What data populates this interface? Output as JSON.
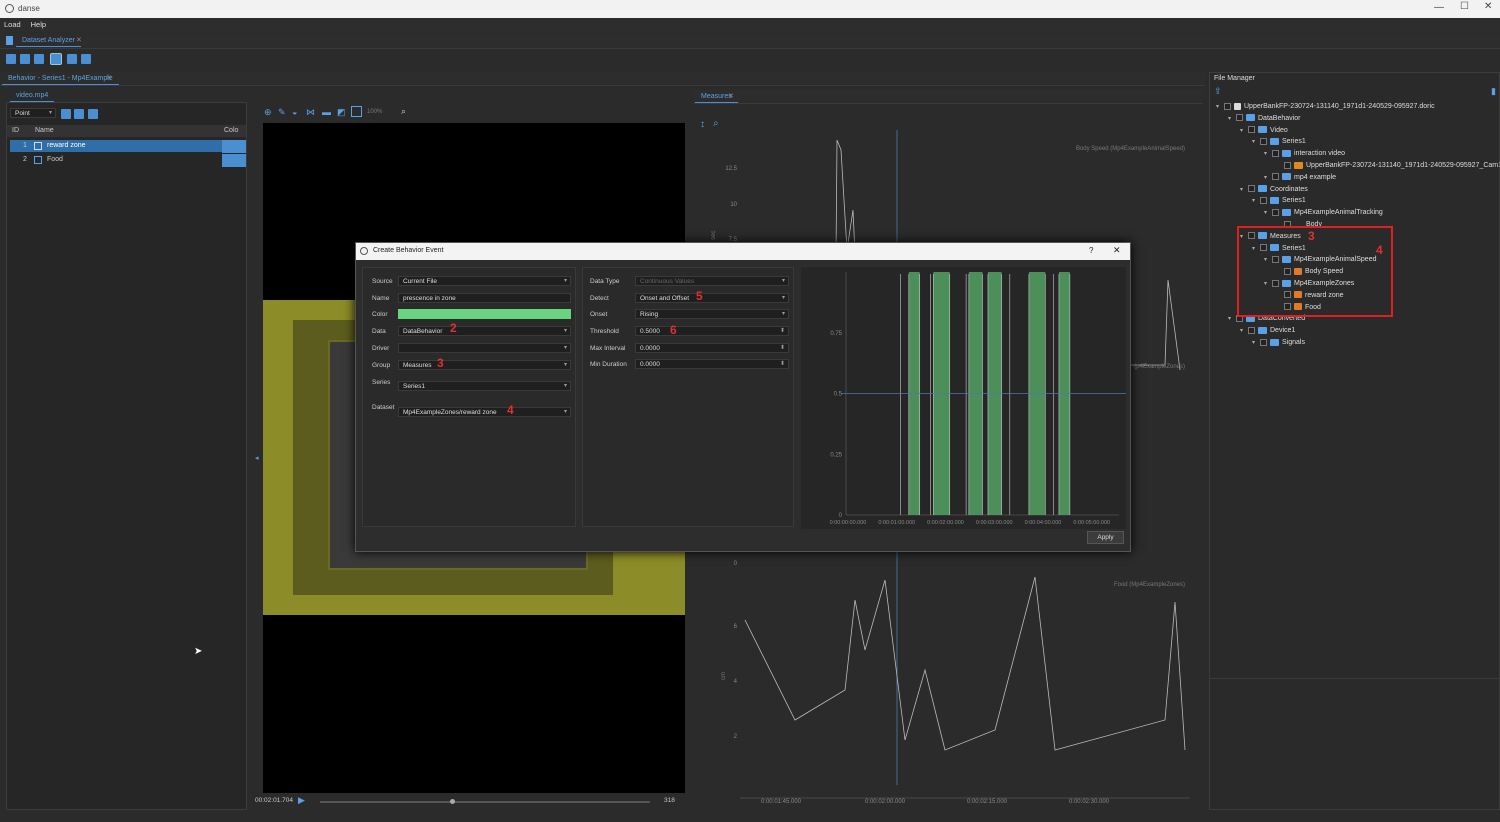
{
  "app": {
    "title": "danse",
    "menu": [
      "Load",
      "Help"
    ]
  },
  "tabs": {
    "analyzer": "Dataset Analyzer",
    "behavior": "Behavior - Series1 - Mp4Example",
    "video": "video.mp4",
    "measures": "Measures",
    "file_manager": "File Manager"
  },
  "left_panel": {
    "mode": "Point",
    "columns": [
      "ID",
      "Name",
      "Colo"
    ],
    "rows": [
      {
        "id": "1",
        "name": "reward zone"
      },
      {
        "id": "2",
        "name": "Food"
      }
    ]
  },
  "video": {
    "zoom": "100%",
    "time": "00:02:01.704",
    "frame": "318"
  },
  "dialog": {
    "title": "Create Behavior Event",
    "help": "?",
    "left": [
      {
        "label": "Source",
        "value": "Current File"
      },
      {
        "label": "Name",
        "value": "prescence in zone"
      },
      {
        "label": "Color",
        "value": ""
      },
      {
        "label": "Data",
        "value": "DataBehavior"
      },
      {
        "label": "Driver",
        "value": ""
      },
      {
        "label": "Group",
        "value": "Measures"
      },
      {
        "label": "Series",
        "value": "Series1"
      },
      {
        "label": "Dataset",
        "value": "Mp4ExampleZones/reward zone"
      }
    ],
    "right": [
      {
        "label": "Data Type",
        "value": "Continuous Values"
      },
      {
        "label": "Detect",
        "value": "Onset and Offset"
      },
      {
        "label": "Onset",
        "value": "Rising"
      },
      {
        "label": "Threshold",
        "value": "0.5000"
      },
      {
        "label": "Max Interval",
        "value": "0.0000"
      },
      {
        "label": "Min Duration",
        "value": "0.0000"
      }
    ],
    "apply": "Apply",
    "annotations": [
      "2",
      "3",
      "4",
      "5",
      "6"
    ],
    "color_swatch": "#6ad37f"
  },
  "chart_data": {
    "type": "area",
    "y_ticks": [
      "0",
      "0.25",
      "0.5",
      "0.75"
    ],
    "x_ticks": [
      "0:00:00:00.000",
      "0:00:01:00.000",
      "0:00:02:00.000",
      "0:00:03:00.000",
      "0:00:04:00.000",
      "0:00:05:00.000"
    ],
    "threshold": 0.5,
    "event_intervals": [
      [
        0.23,
        0.27
      ],
      [
        0.32,
        0.38
      ],
      [
        0.45,
        0.5
      ],
      [
        0.52,
        0.57
      ],
      [
        0.67,
        0.73
      ],
      [
        0.78,
        0.82
      ]
    ],
    "colors": {
      "event": "#4c8f5a",
      "line": "#c8c8c8",
      "threshold": "#4a7ab0"
    }
  },
  "measures_plots": {
    "top": {
      "title": "Body Speed (Mp4ExampleAnimalSpeed)",
      "y_ticks": [
        "12.5",
        "10",
        "7.5"
      ],
      "ylabel": "sec"
    },
    "mid": {
      "label": "(p4ExampleZones)",
      "y_ticks": [
        "0"
      ]
    },
    "bottom": {
      "title": "Food (Mp4ExampleZones)",
      "y_ticks": [
        "6",
        "4",
        "2"
      ],
      "ylabel": "cm",
      "x_ticks": [
        "0:00:01:45.000",
        "0:00:02:00.000",
        "0:00:02:15.000",
        "0:00:02:30.000"
      ]
    }
  },
  "file_tree": [
    {
      "d": 0,
      "t": "file",
      "label": "UpperBankFP-230724-131140_1971d1-240529-095927.doric"
    },
    {
      "d": 1,
      "t": "folder",
      "label": "DataBehavior"
    },
    {
      "d": 2,
      "t": "folder",
      "label": "Video"
    },
    {
      "d": 3,
      "t": "folder",
      "label": "Series1"
    },
    {
      "d": 4,
      "t": "folder",
      "label": "interaction video"
    },
    {
      "d": 5,
      "t": "video",
      "label": "UpperBankFP-230724-131140_1971d1-240529-095927_Cam1..."
    },
    {
      "d": 4,
      "t": "folder",
      "label": "mp4 example"
    },
    {
      "d": 2,
      "t": "folder",
      "label": "Coordinates"
    },
    {
      "d": 3,
      "t": "folder",
      "label": "Series1"
    },
    {
      "d": 4,
      "t": "folder",
      "label": "Mp4ExampleAnimalTracking"
    },
    {
      "d": 5,
      "t": "leaf",
      "label": "Body"
    },
    {
      "d": 2,
      "t": "folder",
      "label": "Measures"
    },
    {
      "d": 3,
      "t": "folder",
      "label": "Series1"
    },
    {
      "d": 4,
      "t": "folder",
      "label": "Mp4ExampleAnimalSpeed"
    },
    {
      "d": 5,
      "t": "signal",
      "label": "Body Speed"
    },
    {
      "d": 4,
      "t": "folder",
      "label": "Mp4ExampleZones"
    },
    {
      "d": 5,
      "t": "signal",
      "label": "reward zone"
    },
    {
      "d": 5,
      "t": "signal",
      "label": "Food"
    },
    {
      "d": 1,
      "t": "folder",
      "label": "DataConverted"
    },
    {
      "d": 2,
      "t": "folder",
      "label": "Device1"
    },
    {
      "d": 3,
      "t": "folder",
      "label": "Signals"
    }
  ],
  "tree_annotations": [
    "3",
    "4"
  ]
}
